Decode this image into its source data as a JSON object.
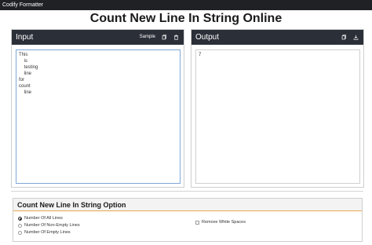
{
  "app": {
    "title": "Codify Formatter"
  },
  "page": {
    "heading": "Count New Line In String Online"
  },
  "input_panel": {
    "title": "Input",
    "sample_label": "Sample",
    "text": "This\n    is\n    testing\n    line\nfor\ncount\n    line"
  },
  "output_panel": {
    "title": "Output",
    "result": "7"
  },
  "options": {
    "title": "Count New Line In String Option",
    "radios": [
      {
        "label": "Number Of All Lines",
        "selected": true
      },
      {
        "label": "Number Of Non-Empty Lines",
        "selected": false
      },
      {
        "label": "Number Of Empty Lines",
        "selected": false
      }
    ],
    "checkbox": {
      "label": "Remove White Spaces",
      "checked": false
    }
  },
  "icons": {
    "copy": "copy-icon",
    "trash": "trash-icon",
    "download": "download-icon"
  },
  "colors": {
    "header_bg": "#2b2f38",
    "topbar_bg": "#1f2125",
    "textbox_border": "#7ea6d8",
    "accent": "#e6a84a"
  }
}
